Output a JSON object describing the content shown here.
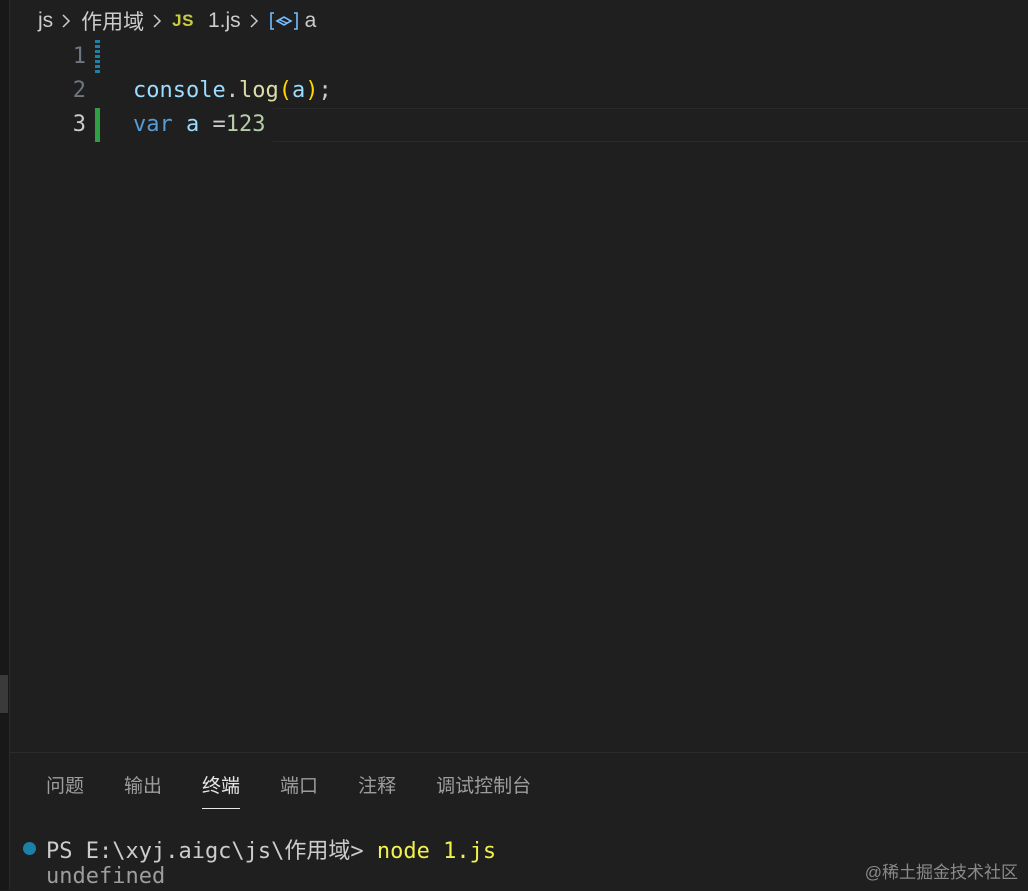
{
  "breadcrumb": {
    "folder": "js",
    "subfolder": "作用域",
    "file_badge": "JS",
    "file": "1.js",
    "symbol": "a",
    "symbol_icon": "variable-icon"
  },
  "editor": {
    "lines": [
      {
        "number": "1"
      },
      {
        "number": "2",
        "tokens": {
          "obj": "console",
          "dot": ".",
          "method": "log",
          "lp": "(",
          "arg": "a",
          "rp": ")",
          "semi": ";"
        }
      },
      {
        "number": "3",
        "tokens": {
          "kw": "var",
          "sp1": " ",
          "name": "a",
          "sp2": " ",
          "op": "=",
          "num": "123"
        }
      }
    ]
  },
  "panel": {
    "tabs": [
      "问题",
      "输出",
      "终端",
      "端口",
      "注释",
      "调试控制台"
    ],
    "active_tab": "终端",
    "terminal": {
      "prompt": "PS E:\\xyj.aigc\\js\\作用域> ",
      "command": "node 1.js",
      "output": "undefined"
    }
  },
  "watermark": "@稀土掘金技术社区",
  "colors": {
    "background": "#1f1f1f",
    "keyword": "#569cd6",
    "variable": "#9cdcfe",
    "function": "#dcdcaa",
    "bracket": "#ffd700",
    "number": "#b5cea8",
    "command": "#f1f14c",
    "added_gutter": "#2ea043",
    "modified_gutter": "#1b81a8"
  }
}
